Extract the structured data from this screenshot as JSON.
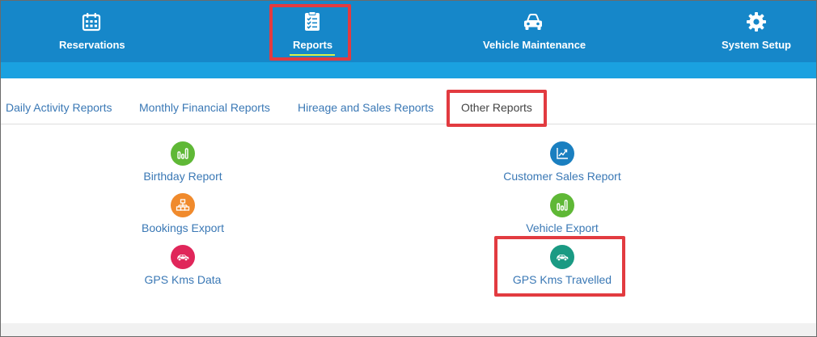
{
  "nav": {
    "items": [
      {
        "label": "Reservations",
        "icon": "calendar-icon"
      },
      {
        "label": "Reports",
        "icon": "clipboard-checklist-icon",
        "active": true
      },
      {
        "label": "Vehicle Maintenance",
        "icon": "car-icon"
      },
      {
        "label": "System Setup",
        "icon": "gear-icon"
      }
    ],
    "colors": {
      "bar": "#1687c9",
      "subbar": "#1aa1e0",
      "underline": "#d8f24a"
    }
  },
  "tabs": [
    {
      "label": "Daily Activity Reports"
    },
    {
      "label": "Monthly Financial Reports"
    },
    {
      "label": "Hireage and Sales Reports"
    },
    {
      "label": "Other Reports",
      "active": true
    }
  ],
  "reports": {
    "left": [
      {
        "label": "Birthday Report",
        "icon": "bar-chart-icon",
        "color": "#5fb836"
      },
      {
        "label": "Bookings Export",
        "icon": "hierarchy-icon",
        "color": "#f08a2c"
      },
      {
        "label": "GPS Kms Data",
        "icon": "car-icon",
        "color": "#e0265a"
      }
    ],
    "right": [
      {
        "label": "Customer Sales Report",
        "icon": "trend-chart-icon",
        "color": "#1a7fc0"
      },
      {
        "label": "Vehicle Export",
        "icon": "bar-chart-icon",
        "color": "#5fb836"
      },
      {
        "label": "GPS Kms Travelled",
        "icon": "car-icon",
        "color": "#1a9a83"
      }
    ]
  },
  "highlight_color": "#e23b40"
}
